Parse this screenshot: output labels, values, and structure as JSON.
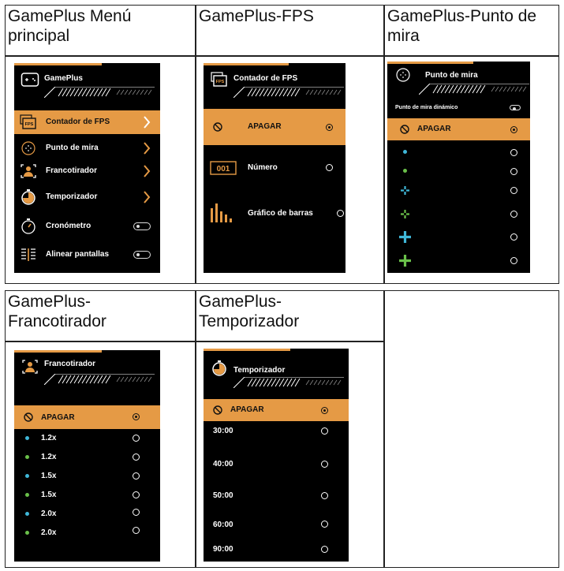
{
  "cells": {
    "main_menu_title": "GamePlus Menú\nprincipal",
    "fps_title": "GamePlus-FPS",
    "crosshair_title": "GamePlus-Punto de\nmira",
    "sniper_title": "GamePlus-\nFrancotirador",
    "timer_title": "GamePlus-\nTemporizador"
  },
  "main_menu": {
    "header": "GamePlus",
    "items": [
      {
        "label": "Contador de FPS"
      },
      {
        "label": "Punto de mira"
      },
      {
        "label": "Francotirador"
      },
      {
        "label": "Temporizador"
      },
      {
        "label": "Cronómetro"
      },
      {
        "label": "Alinear pantallas"
      }
    ]
  },
  "fps": {
    "header": "Contador de FPS",
    "icon_text": "FPS",
    "number_icon_text": "001",
    "items": [
      {
        "label": "APAGAR"
      },
      {
        "label": "Número"
      },
      {
        "label": "Gráfico de barras"
      }
    ]
  },
  "crosshair": {
    "header": "Punto de mira",
    "dynamic_label": "Punto de mira dinámico",
    "off_label": "APAGAR"
  },
  "sniper": {
    "header": "Francotirador",
    "off_label": "APAGAR",
    "options": [
      "1.2x",
      "1.2x",
      "1.5x",
      "1.5x",
      "2.0x",
      "2.0x"
    ]
  },
  "timer": {
    "header": "Temporizador",
    "off_label": "APAGAR",
    "options": [
      "30:00",
      "40:00",
      "50:00",
      "60:00",
      "90:00"
    ]
  },
  "colors": {
    "accent": "#e59a45",
    "panel": "#000000",
    "dot_cyan": "#3fb7d8",
    "dot_green": "#6ac04a"
  }
}
